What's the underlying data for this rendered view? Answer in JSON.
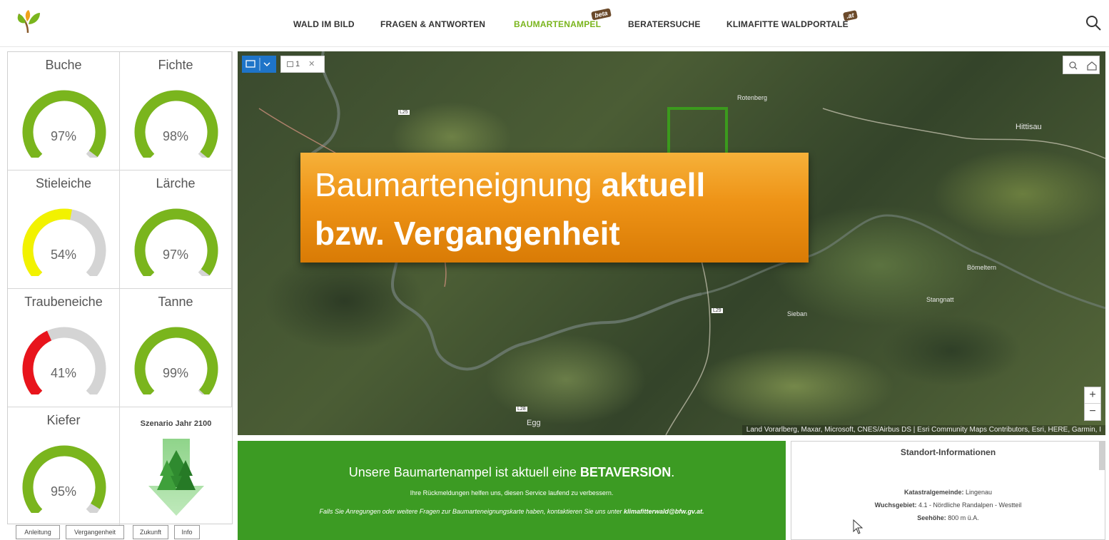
{
  "header": {
    "nav": [
      {
        "label": "WALD IM BILD"
      },
      {
        "label": "FRAGEN & ANTWORTEN"
      },
      {
        "label": "BAUMARTENAMPEL",
        "badge": "beta",
        "active": true
      },
      {
        "label": "BERATERSUCHE"
      },
      {
        "label": "KLIMAFITTE WALDPORTALE",
        "badge": ".at"
      }
    ],
    "icons": {
      "logo": "leaf-logo-icon",
      "search": "search-icon"
    }
  },
  "gauges": [
    {
      "name": "Buche",
      "value": 0.97,
      "label": "97%",
      "color": "#7ab51d"
    },
    {
      "name": "Fichte",
      "value": 0.98,
      "label": "98%",
      "color": "#7ab51d"
    },
    {
      "name": "Stieleiche",
      "value": 0.54,
      "label": "54%",
      "color": "#f2f200"
    },
    {
      "name": "Lärche",
      "value": 0.97,
      "label": "97%",
      "color": "#7ab51d"
    },
    {
      "name": "Traubeneiche",
      "value": 0.41,
      "label": "41%",
      "color": "#e8141c"
    },
    {
      "name": "Tanne",
      "value": 0.99,
      "label": "99%",
      "color": "#7ab51d"
    },
    {
      "name": "Kiefer",
      "value": 0.95,
      "label": "95%",
      "color": "#7ab51d"
    }
  ],
  "scenario": {
    "label": "Szenario Jahr 2100",
    "icon": "down-arrow-trees-icon"
  },
  "tabs": [
    {
      "label": "Anleitung"
    },
    {
      "label": "Vergangenheit"
    },
    {
      "label": "Zukunft"
    },
    {
      "label": "Info"
    }
  ],
  "map": {
    "layer_label": "1",
    "overlay": {
      "line1_normal": "Baumarteneignung ",
      "line1_bold": "aktuell",
      "line2_bold": "bzw. Vergangenheit"
    },
    "zoom_in": "+",
    "zoom_out": "−",
    "attribution": "Land Vorarlberg, Maxar, Microsoft, CNES/Airbus DS | Esri Community Maps Contributors, Esri, HERE, Garmin, I",
    "places": [
      "Hittisau",
      "Egg",
      "Sieban",
      "Stangnatt",
      "Bömeltern",
      "Rotenberg",
      "L25",
      "L28",
      "L29"
    ]
  },
  "beta": {
    "title_normal": "Unsere Baumartenampel ist aktuell eine ",
    "title_bold": "BETAVERSION",
    "title_end": ".",
    "subtitle": "Ihre Rückmeldungen helfen uns, diesen Service laufend zu verbessern.",
    "contact_text": "Falls Sie Anregungen oder weitere Fragen zur Baumarteneignungskarte haben, kontaktieren Sie uns unter ",
    "contact_email": "klimafitterwald@bfw.gv.at."
  },
  "site": {
    "title": "Standort-Informationen",
    "rows": [
      {
        "key": "Katastralgemeinde:",
        "value": " Lingenau"
      },
      {
        "key": "Wuchsgebiet:",
        "value": " 4.1 - Nördliche Randalpen - Westteil"
      },
      {
        "key": "Seehöhe:",
        "value": " 800 m ü.A."
      }
    ]
  }
}
